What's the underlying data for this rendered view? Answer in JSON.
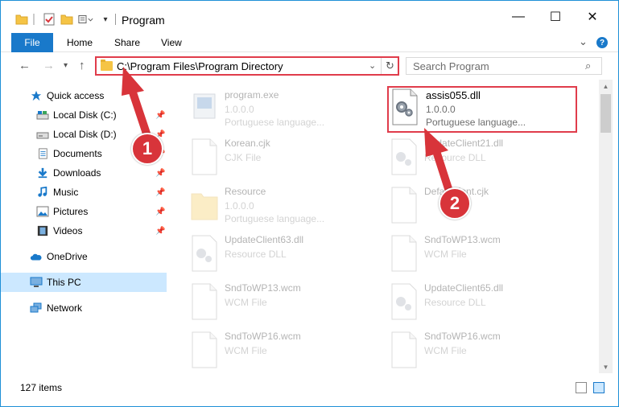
{
  "window": {
    "title": "Program",
    "controls": {
      "minimize": "—",
      "maximize": "☐",
      "close": "✕"
    }
  },
  "ribbon": {
    "tabs": [
      "File",
      "Home",
      "Share",
      "View"
    ],
    "help": "?"
  },
  "nav": {
    "address": "C:\\Program Files\\Program Directory",
    "search_placeholder": "Search Program"
  },
  "sidebar": {
    "items": [
      {
        "label": "Quick access",
        "icon": "star-icon",
        "pinned": false
      },
      {
        "label": "Local Disk (C:)",
        "icon": "drive-icon",
        "pinned": true
      },
      {
        "label": "Local Disk (D:)",
        "icon": "drive-icon",
        "pinned": true
      },
      {
        "label": "Documents",
        "icon": "documents-icon",
        "pinned": true
      },
      {
        "label": "Downloads",
        "icon": "download-icon",
        "pinned": true
      },
      {
        "label": "Music",
        "icon": "music-icon",
        "pinned": true
      },
      {
        "label": "Pictures",
        "icon": "pictures-icon",
        "pinned": true
      },
      {
        "label": "Videos",
        "icon": "videos-icon",
        "pinned": true
      },
      {
        "label": "OneDrive",
        "icon": "cloud-icon",
        "pinned": false
      },
      {
        "label": "This PC",
        "icon": "pc-icon",
        "pinned": false,
        "selected": true
      },
      {
        "label": "Network",
        "icon": "network-icon",
        "pinned": false
      }
    ]
  },
  "files": [
    {
      "name": "program.exe",
      "line1": "1.0.0.0",
      "line2": "Portuguese language...",
      "type": "exe",
      "faded": true
    },
    {
      "name": "assis055.dll",
      "line1": "1.0.0.0",
      "line2": "Portuguese language...",
      "type": "dll",
      "faded": false,
      "highlight": true
    },
    {
      "name": "Korean.cjk",
      "line1": "CJK File",
      "line2": "",
      "type": "doc",
      "faded": true
    },
    {
      "name": "UpdateClient21.dll",
      "line1": "Resource DLL",
      "line2": "",
      "type": "dll",
      "faded": true
    },
    {
      "name": "Resource",
      "line1": "1.0.0.0",
      "line2": "Portuguese language...",
      "type": "folder",
      "faded": true
    },
    {
      "name": "DefaultFont.cjk",
      "line1": "",
      "line2": "",
      "type": "doc",
      "faded": true
    },
    {
      "name": "UpdateClient63.dll",
      "line1": "Resource DLL",
      "line2": "",
      "type": "dll",
      "faded": true
    },
    {
      "name": "SndToWP13.wcm",
      "line1": "WCM File",
      "line2": "",
      "type": "doc",
      "faded": true
    },
    {
      "name": "SndToWP13.wcm",
      "line1": "WCM File",
      "line2": "",
      "type": "doc",
      "faded": true
    },
    {
      "name": "UpdateClient65.dll",
      "line1": "Resource DLL",
      "line2": "",
      "type": "dll",
      "faded": true
    },
    {
      "name": "SndToWP16.wcm",
      "line1": "WCM File",
      "line2": "",
      "type": "doc",
      "faded": true
    },
    {
      "name": "SndToWP16.wcm",
      "line1": "WCM File",
      "line2": "",
      "type": "doc",
      "faded": true
    }
  ],
  "status": {
    "items_count": "127 items"
  },
  "annotations": {
    "badge1": "1",
    "badge2": "2",
    "color": "#d8343a"
  }
}
